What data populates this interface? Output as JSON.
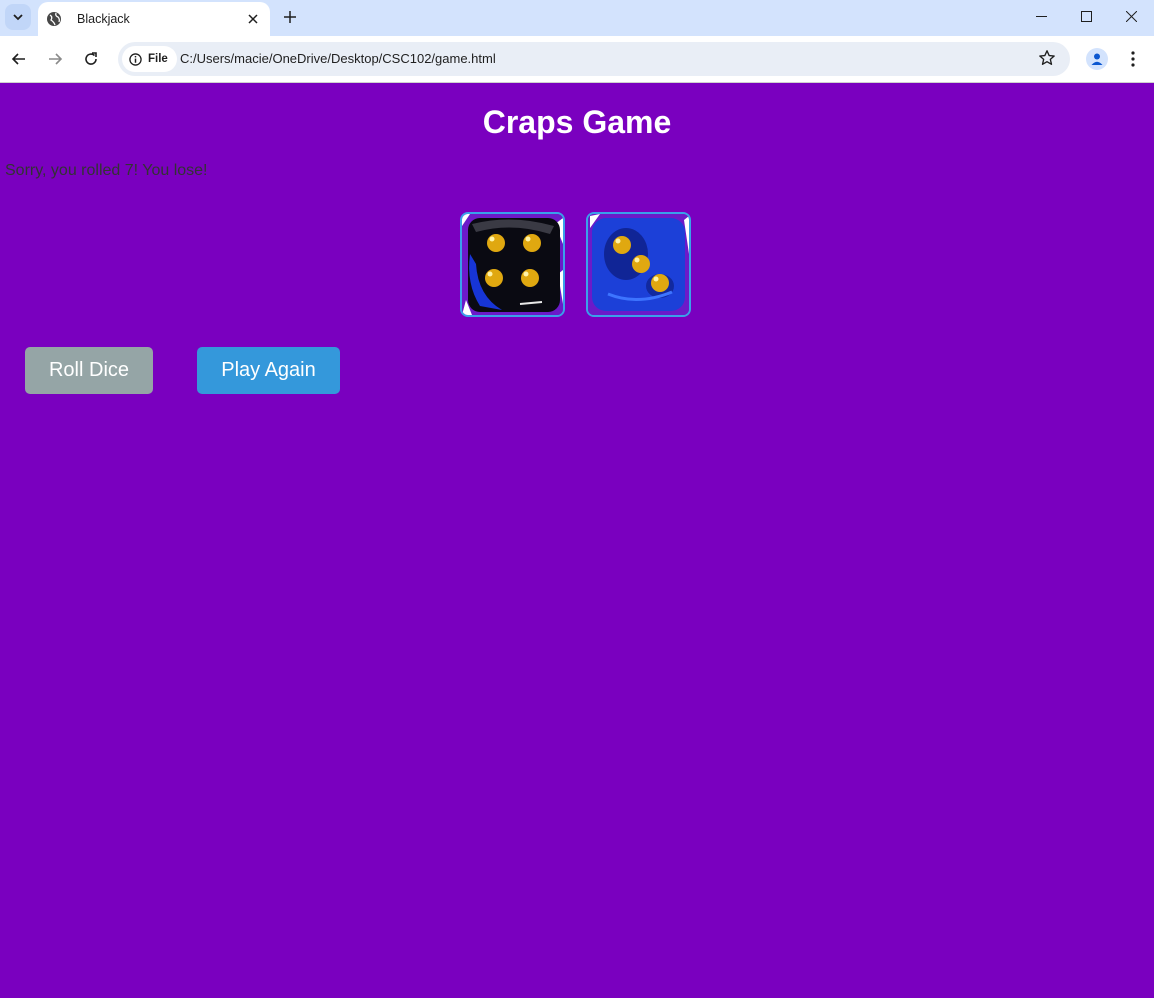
{
  "browser": {
    "tab_title": "Blackjack",
    "chip_label": "File",
    "url": "C:/Users/macie/OneDrive/Desktop/CSC102/game.html",
    "icons": [
      "tab-search-icon",
      "globe-icon",
      "close-icon",
      "plus-icon",
      "minimize-icon",
      "maximize-icon",
      "window-close-icon",
      "back-icon",
      "forward-icon",
      "reload-icon",
      "info-icon",
      "star-icon",
      "profile-icon",
      "more-icon"
    ]
  },
  "game": {
    "title": "Craps Game",
    "message": "Sorry, you rolled 7! You lose!",
    "dice": [
      {
        "value": 4,
        "color": "black"
      },
      {
        "value": 3,
        "color": "blue"
      }
    ],
    "roll_button": "Roll Dice",
    "play_again_button": "Play Again"
  },
  "colors": {
    "page_background": "#7a00bf",
    "roll_button": "#95a5a6",
    "play_again_button": "#3498db",
    "die_border": "#3aa0ea",
    "pip": "#e0a810"
  }
}
